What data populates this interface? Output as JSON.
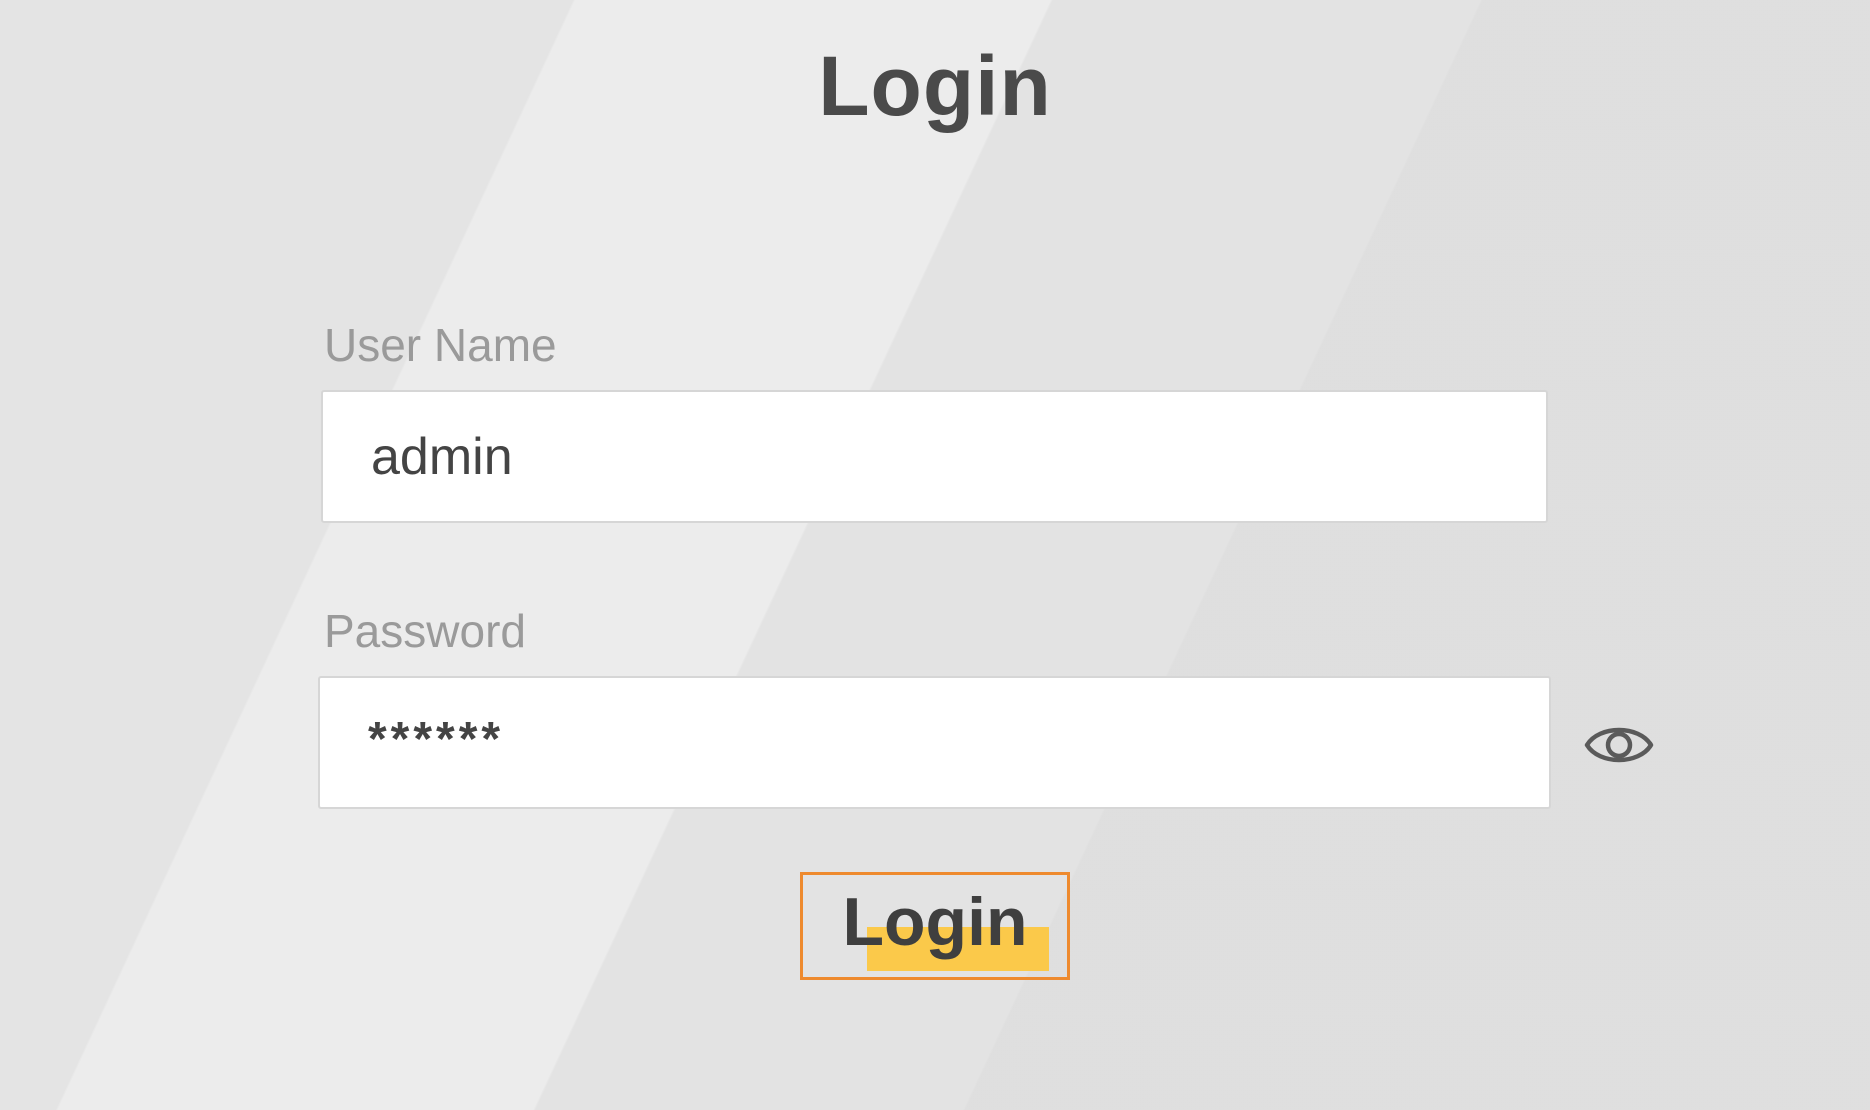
{
  "page": {
    "title": "Login"
  },
  "form": {
    "username": {
      "label": "User Name",
      "value": "admin"
    },
    "password": {
      "label": "Password",
      "value_masked": "******",
      "reveal_icon": "eye-icon"
    },
    "submit": {
      "label": "Login",
      "border_color": "#ee8a2e",
      "highlight_color": "#fbc94a"
    }
  }
}
